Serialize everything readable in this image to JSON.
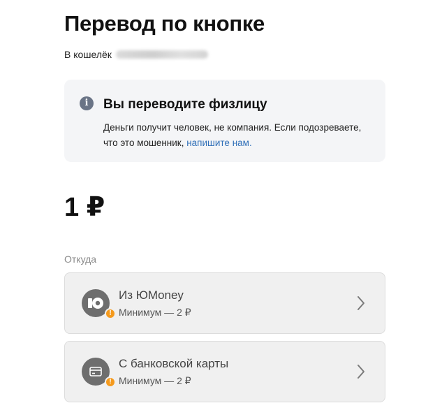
{
  "page_title": "Перевод по кнопке",
  "recipient": {
    "label": "В кошелёк"
  },
  "notice": {
    "heading": "Вы переводите физлицу",
    "text": "Деньги получит человек, не компания. Если подозреваете, что это мошенник,",
    "link": "напишите нам."
  },
  "amount": "1 ₽",
  "from_label": "Откуда",
  "sources": [
    {
      "name": "Из ЮMoney",
      "min": "Минимум — 2 ₽",
      "icon": "yoomoney-logo-icon"
    },
    {
      "name": "С банковской карты",
      "min": "Минимум — 2 ₽",
      "icon": "bank-card-icon"
    }
  ],
  "colors": {
    "link": "#2f6fb8",
    "warning_badge": "#f59a1d",
    "info_icon": "#6a7486",
    "card_bg": "#f0f0f0"
  }
}
